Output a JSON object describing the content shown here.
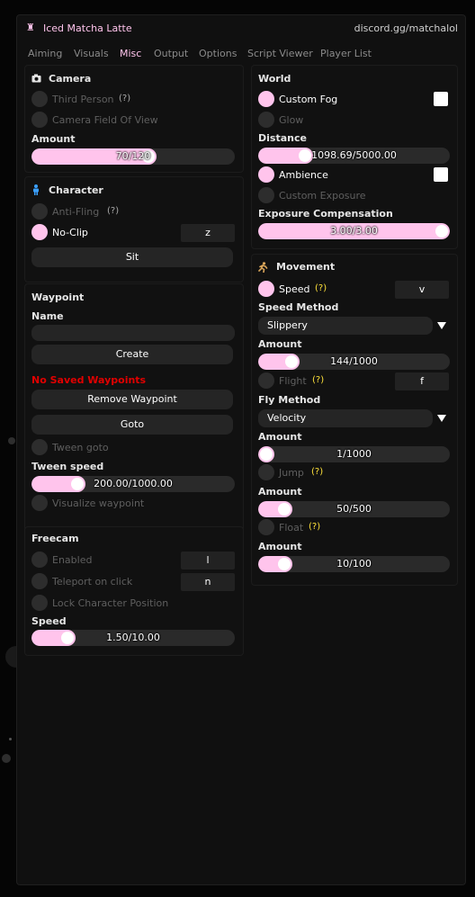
{
  "app": {
    "title": "Iced Matcha Latte",
    "link": "discord.gg/matchalol"
  },
  "colors": {
    "accent": "#ffc4ec",
    "error": "#e00000",
    "help": "#ffe23a"
  },
  "tabs": [
    {
      "label": "Aiming"
    },
    {
      "label": "Visuals"
    },
    {
      "label": "Misc",
      "active": true
    },
    {
      "label": "Output"
    },
    {
      "label": "Options"
    },
    {
      "label": "Script Viewer"
    },
    {
      "label": "Player List"
    }
  ],
  "camera": {
    "header": "Camera",
    "icon": "camera-icon",
    "third_person": {
      "label": "Third Person",
      "help": "(?)",
      "checked": false
    },
    "fov": {
      "label": "Camera Field Of View",
      "checked": false
    },
    "amount_label": "Amount",
    "amount": {
      "text": "70/120",
      "value": 70,
      "max": 120
    }
  },
  "character": {
    "header": "Character",
    "icon": "person-icon",
    "anti_fling": {
      "label": "Anti-Fling",
      "help": "(?)",
      "checked": false
    },
    "noclip": {
      "label": "No-Clip",
      "checked": true,
      "key": "z"
    },
    "sit_label": "Sit"
  },
  "waypoint": {
    "header": "Waypoint",
    "name_label": "Name",
    "name_value": "",
    "create_label": "Create",
    "empty_message": "No Saved Waypoints",
    "remove_label": "Remove Waypoint",
    "goto_label": "Goto",
    "tween_goto": {
      "label": "Tween goto",
      "checked": false
    },
    "tween_speed_label": "Tween speed",
    "tween_speed": {
      "text": "200.00/1000.00",
      "value": 200,
      "max": 1000
    },
    "visualize": {
      "label": "Visualize waypoint",
      "checked": false
    }
  },
  "freecam": {
    "header": "Freecam",
    "enabled": {
      "label": "Enabled",
      "checked": false,
      "key": "l"
    },
    "teleport": {
      "label": "Teleport on click",
      "checked": false,
      "key": "n"
    },
    "lock": {
      "label": "Lock Character Position",
      "checked": false
    },
    "speed_label": "Speed",
    "speed": {
      "text": "1.50/10.00",
      "value": 1.5,
      "max": 10
    }
  },
  "world": {
    "header": "World",
    "custom_fog": {
      "label": "Custom Fog",
      "checked": true,
      "color": "#ffffff"
    },
    "glow": {
      "label": "Glow",
      "checked": false
    },
    "distance_label": "Distance",
    "distance": {
      "text": "1098.69/5000.00",
      "value": 1098.69,
      "max": 5000
    },
    "ambience": {
      "label": "Ambience",
      "checked": true,
      "color": "#ffffff"
    },
    "custom_exposure": {
      "label": "Custom Exposure",
      "checked": false
    },
    "exposure_label": "Exposure Compensation",
    "exposure": {
      "text": "3.00/3.00",
      "value": 3,
      "max": 3
    }
  },
  "movement": {
    "header": "Movement",
    "icon": "running-icon",
    "speed": {
      "label": "Speed",
      "help": "(?)",
      "checked": true,
      "key": "v"
    },
    "speed_method_label": "Speed Method",
    "speed_method": "Slippery",
    "speed_amount_label": "Amount",
    "speed_amount": {
      "text": "144/1000",
      "value": 144,
      "max": 1000
    },
    "flight": {
      "label": "Flight",
      "help": "(?)",
      "checked": false,
      "key": "f"
    },
    "fly_method_label": "Fly Method",
    "fly_method": "Velocity",
    "fly_amount_label": "Amount",
    "fly_amount": {
      "text": "1/1000",
      "value": 1,
      "max": 1000
    },
    "jump": {
      "label": "Jump",
      "help": "(?)",
      "checked": false
    },
    "jump_amount_label": "Amount",
    "jump_amount": {
      "text": "50/500",
      "value": 50,
      "max": 500
    },
    "float": {
      "label": "Float",
      "help": "(?)",
      "checked": false
    },
    "float_amount_label": "Amount",
    "float_amount": {
      "text": "10/100",
      "value": 10,
      "max": 100
    }
  }
}
